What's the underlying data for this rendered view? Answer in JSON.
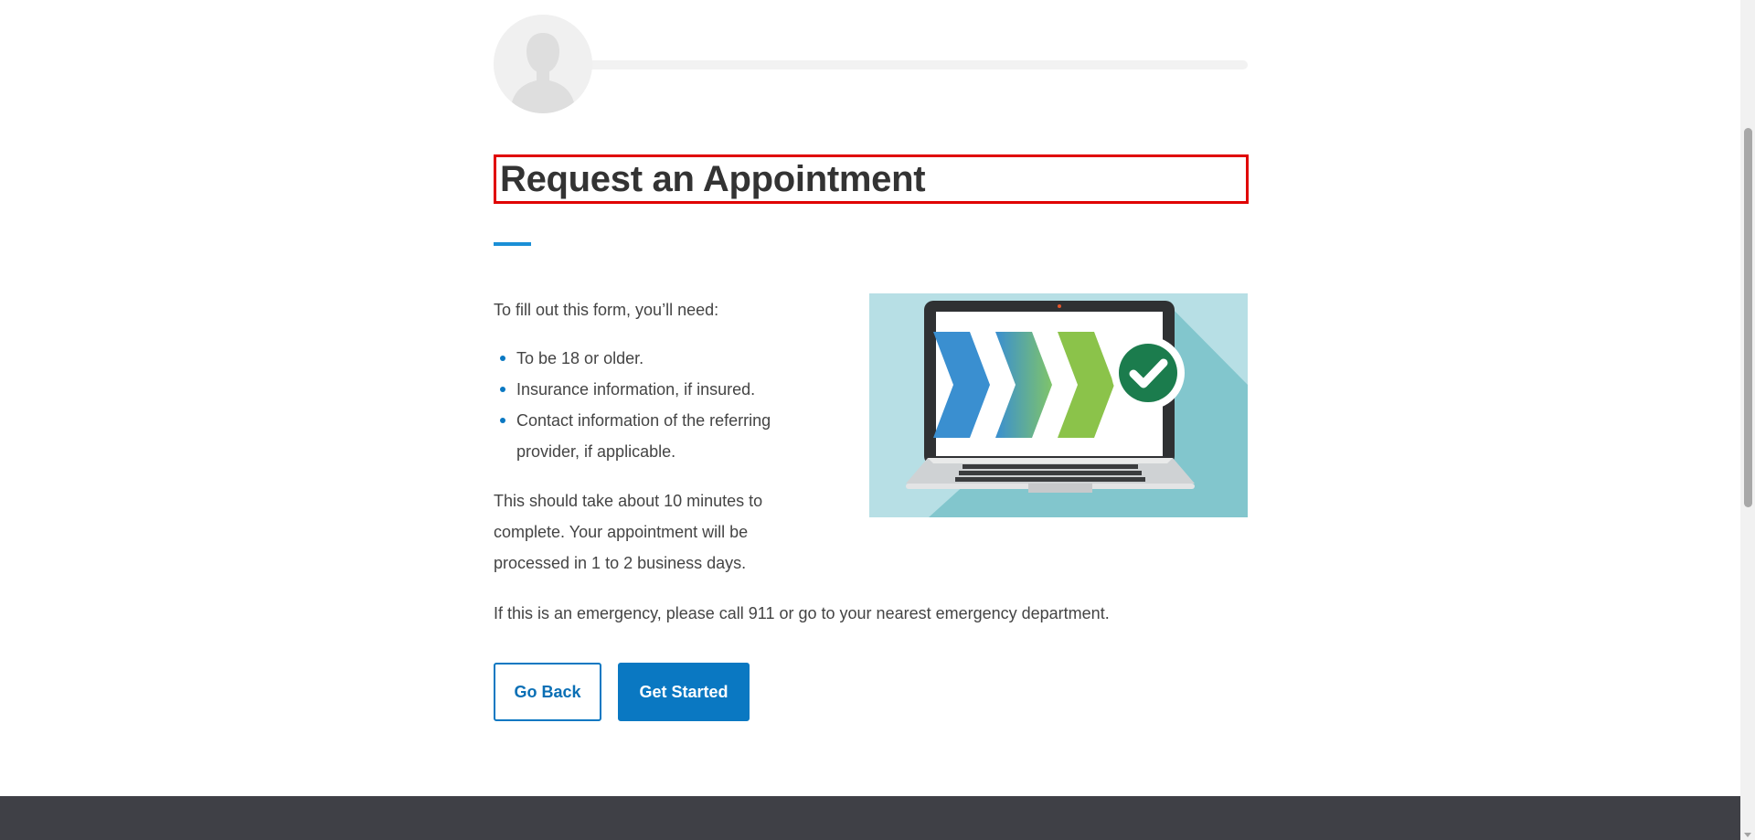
{
  "progress": {
    "value_percent": 0
  },
  "title": "Request an Appointment",
  "intro": "To fill out this form, you’ll need:",
  "requirements": [
    "To be 18 or older.",
    "Insurance information, if insured.",
    "Contact information of the referring provider, if applicable."
  ],
  "duration_text": "This should take about 10 minutes to complete. Your appointment will be processed in 1 to 2 business days.",
  "emergency_text": "If this is an emergency, please call 911 or go to your nearest emergency department.",
  "buttons": {
    "back_label": "Go Back",
    "start_label": "Get Started"
  },
  "icons": {
    "avatar": "user-silhouette-icon",
    "illustration": "laptop-progress-checkmark-illustration"
  },
  "colors": {
    "accent": "#0a78c2",
    "title_outline": "#e00000",
    "illustration_bg": "#b7dfe5",
    "check_circle": "#1b7c4d",
    "footer": "#3f4046"
  }
}
